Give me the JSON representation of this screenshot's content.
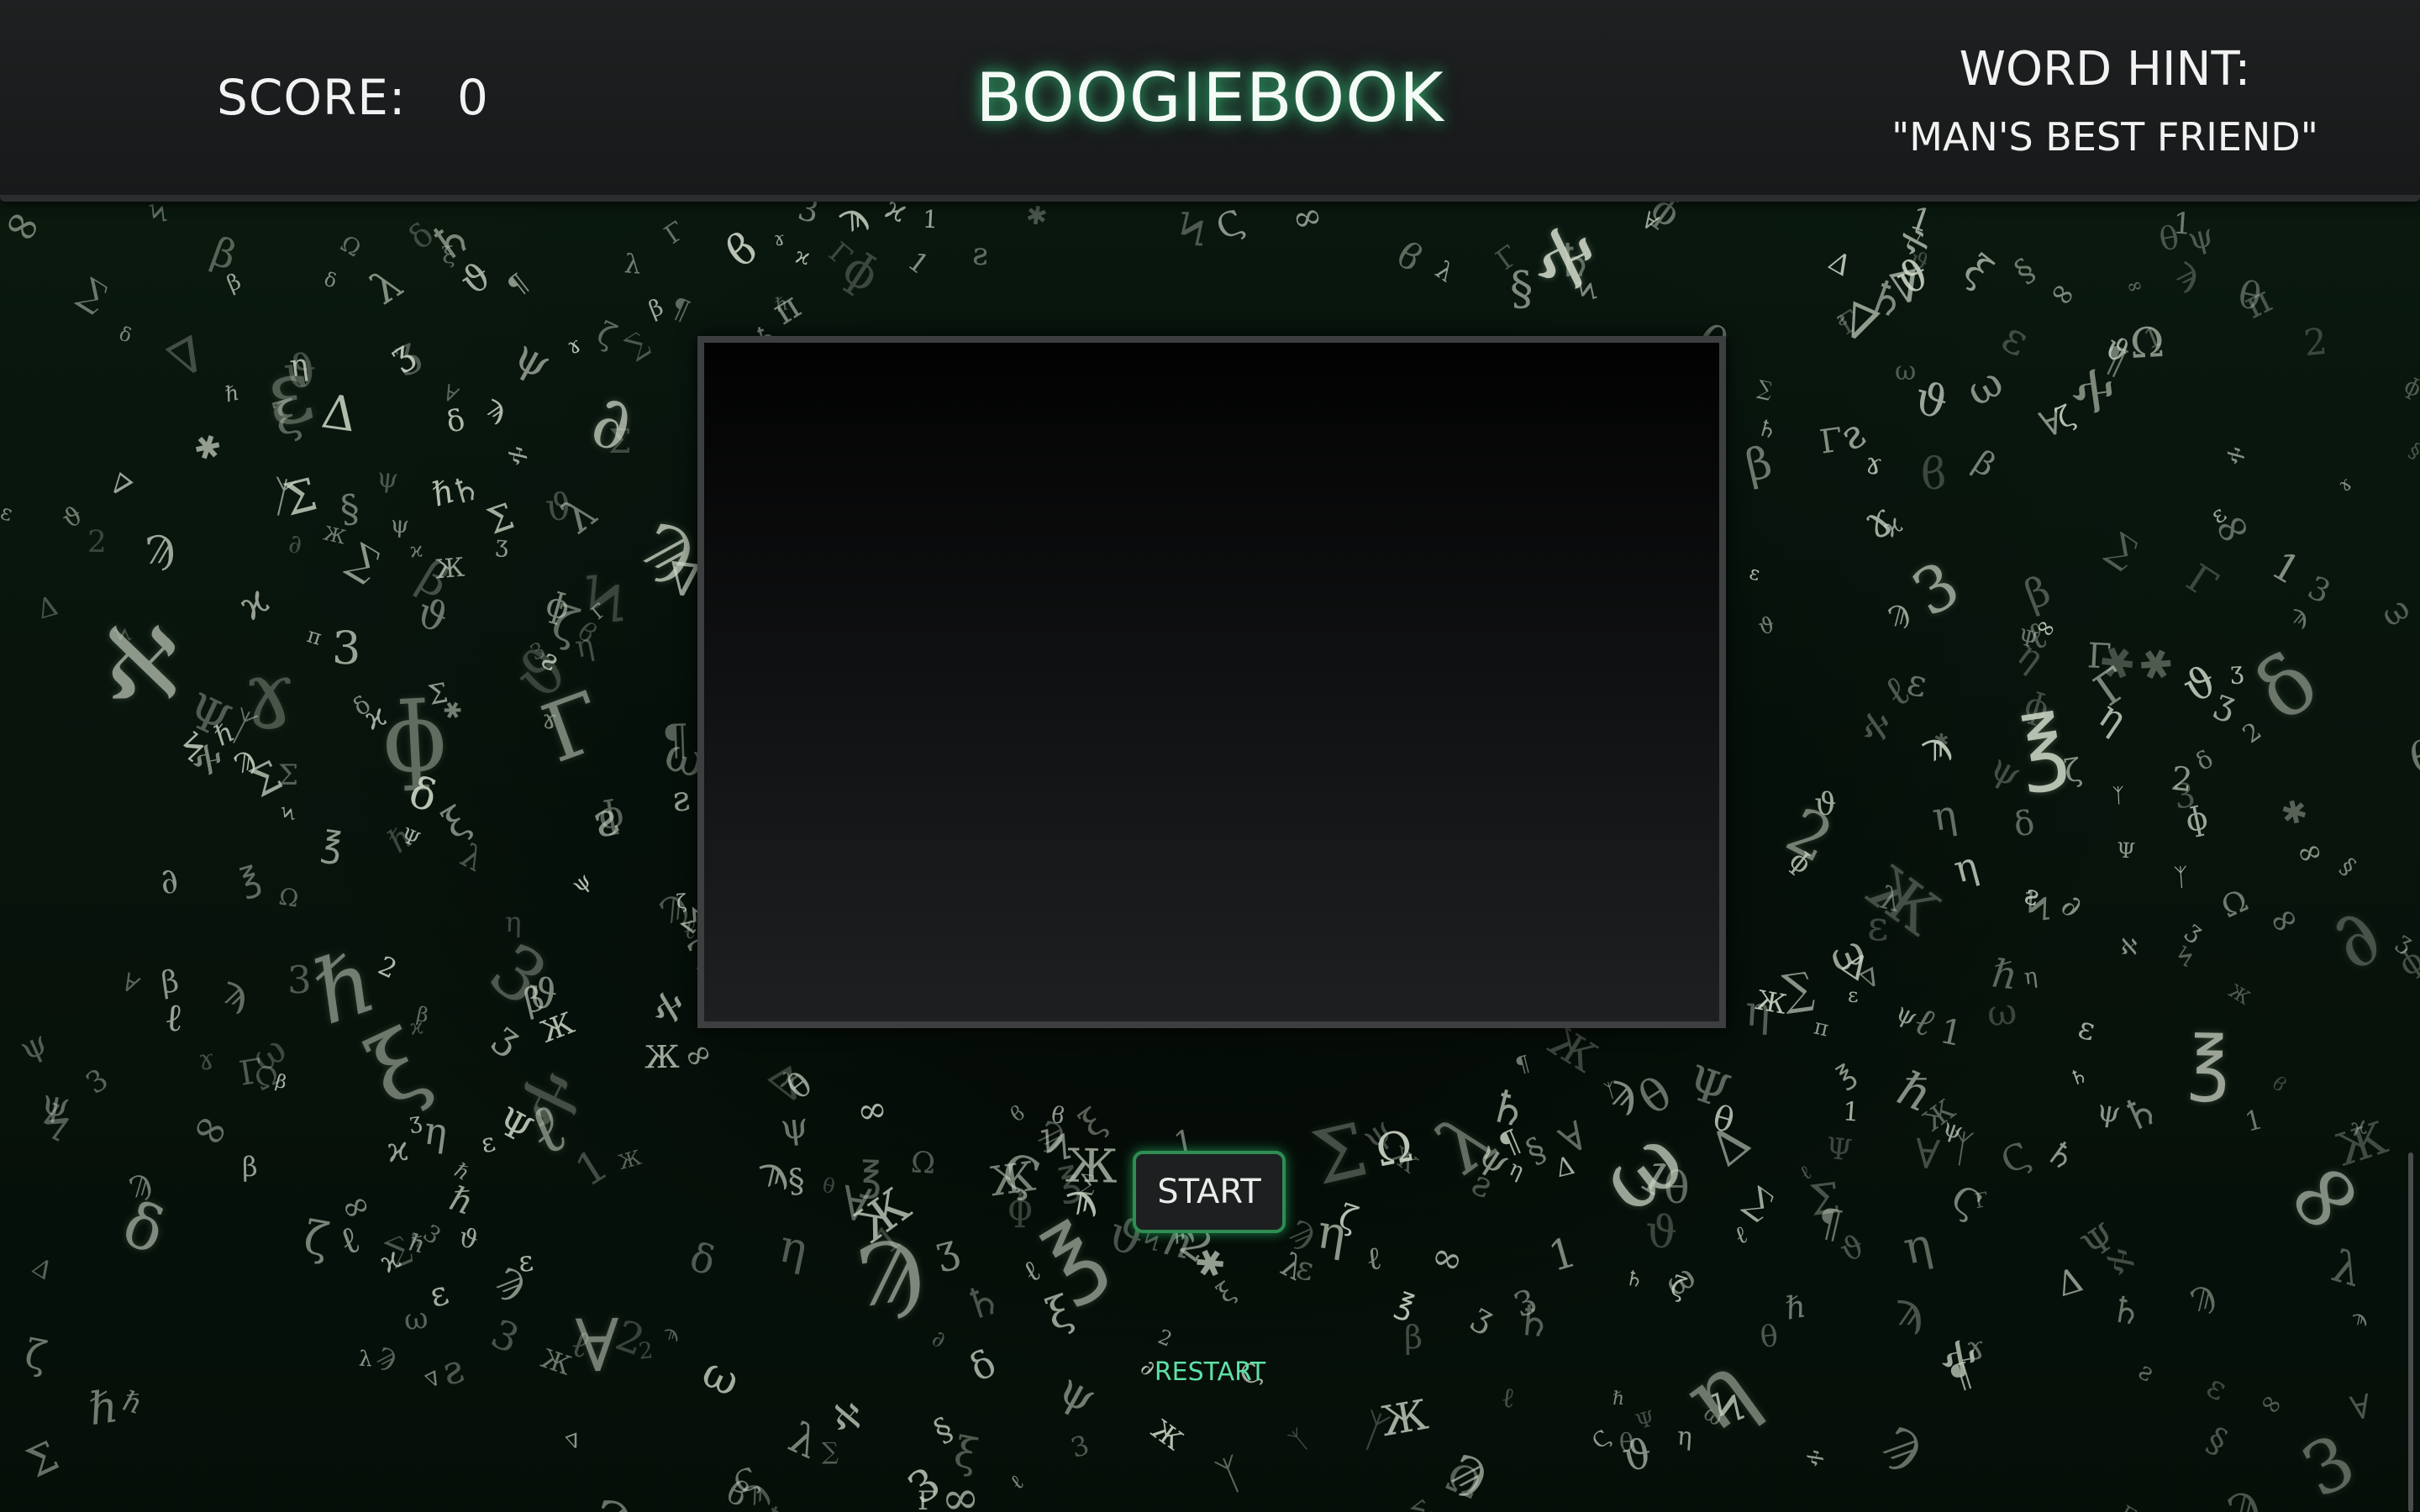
{
  "header": {
    "score_label": "SCORE:",
    "score_value": "0",
    "title": "BOOGIEBOOK",
    "hint_label": "WORD HINT:",
    "hint_value": "\"MAN'S BEST FRIEND\""
  },
  "controls": {
    "start_label": "START",
    "restart_label": "RESTART"
  },
  "background": {
    "glyph_set": [
      "δ",
      "θ",
      "λ",
      "Ω",
      "π",
      "Σ",
      "Δ",
      "ψ",
      "ξ",
      "ζ",
      "ɛ",
      "℥",
      "ω",
      "η",
      "ϐ",
      "∂",
      "1",
      "2",
      "3",
      "∀",
      "ℓ",
      "β",
      "Ж",
      "Ψ",
      "Γ",
      "ƨ",
      "ɤ",
      "ʒ",
      "Ϡ",
      "ϡ",
      "Ϟ",
      "Ϛ",
      "ᛉ",
      "∇",
      "∑",
      "ℵ",
      "§",
      "¶",
      "✱",
      "∞",
      "♄",
      "ɸ",
      "ϰ",
      "ϑ",
      "ℏ"
    ]
  },
  "colors": {
    "accent_glow": "#2f8c52",
    "restart_text": "#5fe0a6",
    "board_border": "#3c3e40"
  }
}
